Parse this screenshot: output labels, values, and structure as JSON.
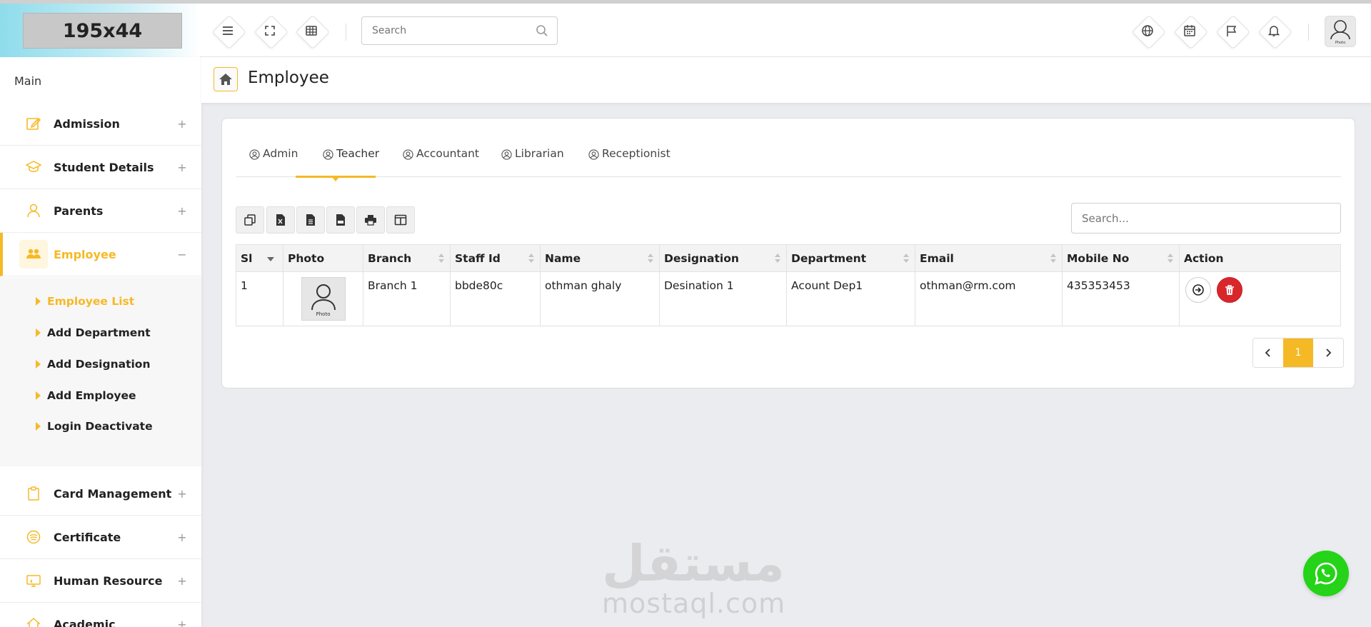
{
  "logo": {
    "text": "195x44"
  },
  "header": {
    "search_placeholder": "Search",
    "avatar_caption": "Photo"
  },
  "sidebar": {
    "section_label": "Main",
    "items": [
      {
        "label": "Admission",
        "toggle": "+"
      },
      {
        "label": "Student Details",
        "toggle": "+"
      },
      {
        "label": "Parents",
        "toggle": "+"
      },
      {
        "label": "Employee",
        "toggle": "−"
      },
      {
        "label": "Card Management",
        "toggle": "+"
      },
      {
        "label": "Certificate",
        "toggle": "+"
      },
      {
        "label": "Human Resource",
        "toggle": "+"
      },
      {
        "label": "Academic",
        "toggle": "+"
      }
    ],
    "sub_items": [
      {
        "label": "Employee List"
      },
      {
        "label": "Add Department"
      },
      {
        "label": "Add Designation"
      },
      {
        "label": "Add Employee"
      },
      {
        "label": "Login Deactivate"
      }
    ]
  },
  "breadcrumb": {
    "title": "Employee"
  },
  "tabs": [
    {
      "label": "Admin"
    },
    {
      "label": "Teacher"
    },
    {
      "label": "Accountant"
    },
    {
      "label": "Librarian"
    },
    {
      "label": "Receptionist"
    }
  ],
  "table": {
    "search_placeholder": "Search...",
    "columns": [
      "Sl",
      "Photo",
      "Branch",
      "Staff Id",
      "Name",
      "Designation",
      "Department",
      "Email",
      "Mobile No",
      "Action"
    ],
    "rows": [
      {
        "sl": "1",
        "photo_caption": "Photo",
        "branch": "Branch 1",
        "staff_id": "bbde80c",
        "name": "othman ghaly",
        "designation": "Desination 1",
        "department": "Acount Dep1",
        "email": "othman@rm.com",
        "mobile": "435353453"
      }
    ]
  },
  "pagination": {
    "current": "1"
  },
  "watermark": {
    "arabic": "مستقل",
    "latin": "mostaql.com"
  },
  "colors": {
    "accent": "#f6b926",
    "danger": "#d9262b",
    "whatsapp": "#25d318"
  }
}
